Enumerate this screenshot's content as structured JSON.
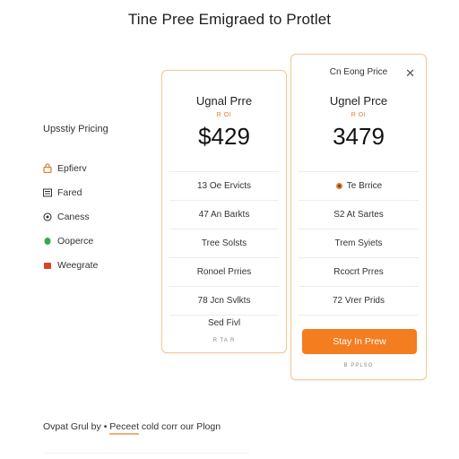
{
  "page": {
    "title": "Tine Pree Emigraed to Protlet"
  },
  "sidebar": {
    "heading": "Upsstiy Pricing",
    "items": [
      {
        "label": "Epfierv",
        "icon": "lock-icon",
        "color": "#e07a2c"
      },
      {
        "label": "Fared",
        "icon": "list-icon",
        "color": "#333333"
      },
      {
        "label": "Caness",
        "icon": "globe-icon",
        "color": "#333333"
      },
      {
        "label": "Ooperce",
        "icon": "leaf-icon",
        "color": "#3aa655"
      },
      {
        "label": "Weegrate",
        "icon": "bag-icon",
        "color": "#d9432b"
      }
    ]
  },
  "plans": [
    {
      "name": "Ugnal Prre",
      "sub": "R OI",
      "price": "$429",
      "features": [
        "13 Oe Ervicts",
        "47 An Barkts",
        "Tree Solsts",
        "Ronoel Prries",
        "78 Jcn Svlkts"
      ],
      "footer_label": "Sed Fivl",
      "footer_small": "R TA R"
    },
    {
      "top_label": "Cn Eong Price",
      "name": "Ugnel Prce",
      "sub": "R OI",
      "price": "3479",
      "features": [
        "Te Brrice",
        "S2 At Sartes",
        "Trem Syiets",
        "Rcocrt Prres",
        "72 Vrer Prids"
      ],
      "cta_label": "Stay In Prew",
      "footer_small": "B PPLSO"
    }
  ],
  "bottom_note": {
    "text": "Ovpat Grul by •",
    "link": "Peceet",
    "rest": "cold corr our Plogn"
  },
  "colors": {
    "accent": "#f47d20",
    "card_border": "#f3c892"
  }
}
